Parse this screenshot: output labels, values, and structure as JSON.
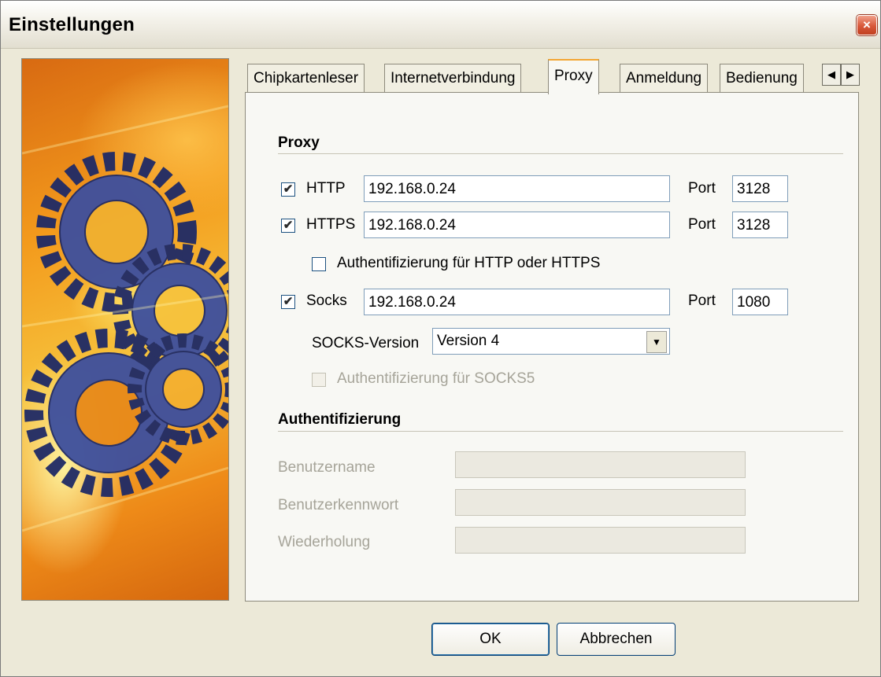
{
  "window": {
    "title": "Einstellungen",
    "close_label": "×"
  },
  "tabs": [
    {
      "label": "Chipkartenleser",
      "active": false
    },
    {
      "label": "Internetverbindung",
      "active": false
    },
    {
      "label": "Proxy",
      "active": true
    },
    {
      "label": "Anmeldung",
      "active": false
    },
    {
      "label": "Bedienung",
      "active": false
    }
  ],
  "tab_scroll": {
    "left": "◀",
    "right": "▶"
  },
  "proxy": {
    "section_title": "Proxy",
    "port_label": "Port",
    "http": {
      "label": "HTTP",
      "checked": true,
      "host": "192.168.0.24",
      "port": "3128"
    },
    "https": {
      "label": "HTTPS",
      "checked": true,
      "host": "192.168.0.24",
      "port": "3128"
    },
    "http_auth": {
      "label": "Authentifizierung für HTTP oder HTTPS",
      "checked": false
    },
    "socks": {
      "label": "Socks",
      "checked": true,
      "host": "192.168.0.24",
      "port": "1080"
    },
    "socks_version": {
      "label": "SOCKS-Version",
      "value": "Version 4"
    },
    "socks5_auth": {
      "label": "Authentifizierung für SOCKS5",
      "checked": false,
      "enabled": false
    }
  },
  "auth": {
    "section_title": "Authentifizierung",
    "username": {
      "label": "Benutzername",
      "value": ""
    },
    "password": {
      "label": "Benutzerkennwort",
      "value": ""
    },
    "repeat": {
      "label": "Wiederholung",
      "value": ""
    }
  },
  "buttons": {
    "ok": "OK",
    "cancel": "Abbrechen"
  },
  "colors": {
    "tab_highlight": "#f3a633",
    "gear_blue": "#3d4f9e",
    "image_orange": "#f39a1c"
  },
  "icons": {
    "checkmark": "✔",
    "dropdown": "▼"
  }
}
